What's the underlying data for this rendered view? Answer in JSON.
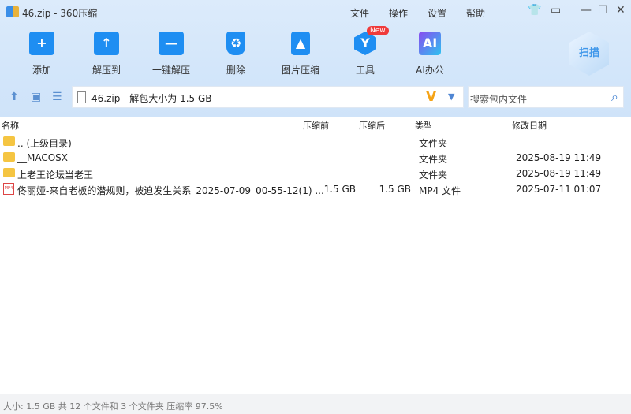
{
  "title": "46.zip - 360压缩",
  "menu": [
    "文件",
    "操作",
    "设置",
    "帮助"
  ],
  "toolbar": [
    {
      "label": "添加",
      "glyph": "+"
    },
    {
      "label": "解压到",
      "glyph": "↑"
    },
    {
      "label": "一键解压",
      "glyph": "—"
    },
    {
      "label": "删除",
      "glyph": "♻"
    },
    {
      "label": "图片压缩",
      "glyph": "▲"
    },
    {
      "label": "工具",
      "glyph": "Y"
    },
    {
      "label": "AI办公",
      "glyph": "AI"
    }
  ],
  "badge": "New",
  "scan": "扫描",
  "address": "46.zip - 解包大小为 1.5 GB",
  "search_placeholder": "搜索包内文件",
  "columns": {
    "name": "名称",
    "packed": "压缩前",
    "size": "压缩后",
    "type": "类型",
    "date": "修改日期"
  },
  "rows": [
    {
      "name": ".. (上级目录)",
      "packed": "",
      "size": "",
      "type": "文件夹",
      "date": "",
      "icon": "folder"
    },
    {
      "name": "__MACOSX",
      "packed": "",
      "size": "",
      "type": "文件夹",
      "date": "2025-08-19 11:49",
      "icon": "folder"
    },
    {
      "name": "上老王论坛当老王",
      "packed": "",
      "size": "",
      "type": "文件夹",
      "date": "2025-08-19 11:49",
      "icon": "folder"
    },
    {
      "name": "佟丽娅-来自老板的潜规则，被迫发生关系_2025-07-09_00-55-12(1) ...",
      "packed": "1.5 GB",
      "size": "1.5 GB",
      "type": "MP4 文件",
      "date": "2025-07-11 01:07",
      "icon": "video"
    }
  ],
  "status": "大小: 1.5 GB 共 12 个文件和 3 个文件夹 压缩率 97.5%"
}
